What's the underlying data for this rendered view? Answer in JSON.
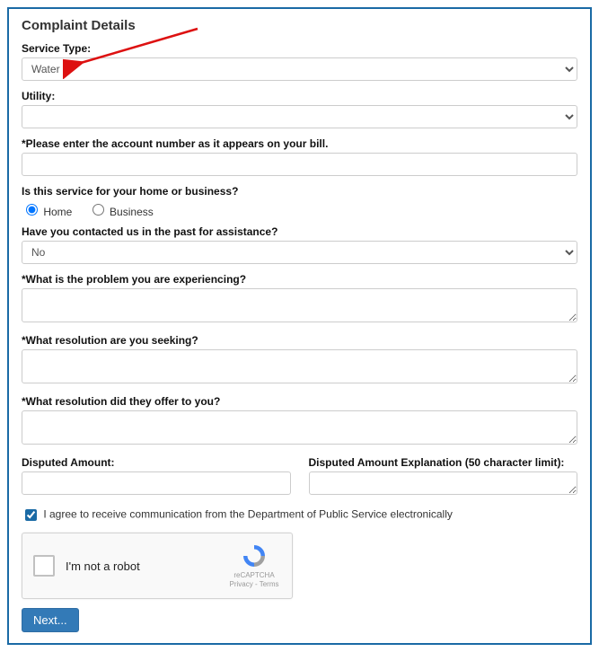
{
  "panel": {
    "title": "Complaint Details"
  },
  "serviceType": {
    "label": "Service Type:",
    "value": "Water"
  },
  "utility": {
    "label": "Utility:",
    "value": ""
  },
  "accountNumber": {
    "label": "*Please enter the account number as it appears on your bill.",
    "value": ""
  },
  "homeBusiness": {
    "label": "Is this service for your home or business?",
    "options": {
      "home": "Home",
      "business": "Business"
    },
    "selected": "home"
  },
  "pastContact": {
    "label": "Have you contacted us in the past for assistance?",
    "value": "No"
  },
  "problem": {
    "label": "*What is the problem you are experiencing?",
    "value": ""
  },
  "resolutionSeeking": {
    "label": "*What resolution are you seeking?",
    "value": ""
  },
  "resolutionOffered": {
    "label": "*What resolution did they offer to you?",
    "value": ""
  },
  "disputedAmount": {
    "label": "Disputed Amount:",
    "value": ""
  },
  "disputedExplanation": {
    "label": "Disputed Amount Explanation (50 character limit):",
    "value": ""
  },
  "consent": {
    "label": "I agree to receive communication from the Department of Public Service electronically",
    "checked": true
  },
  "recaptcha": {
    "text": "I'm not a robot",
    "badge_line1": "reCAPTCHA",
    "badge_line2": "Privacy - Terms"
  },
  "buttons": {
    "next": "Next..."
  }
}
